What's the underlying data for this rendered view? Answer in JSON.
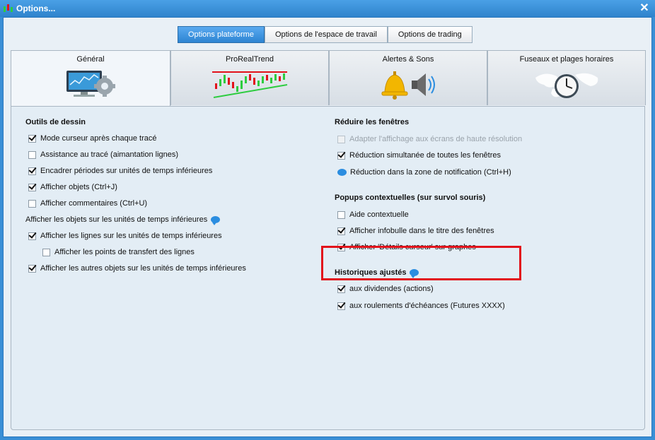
{
  "window": {
    "title": "Options..."
  },
  "top_tabs": [
    {
      "label": "Options plateforme",
      "active": true
    },
    {
      "label": "Options de l'espace de travail",
      "active": false
    },
    {
      "label": "Options de trading",
      "active": false
    }
  ],
  "tabs": [
    {
      "label": "Général",
      "icon": "monitor-gear-icon",
      "active": true
    },
    {
      "label": "ProRealTrend",
      "icon": "trend-chart-icon",
      "active": false
    },
    {
      "label": "Alertes & Sons",
      "icon": "bell-speaker-icon",
      "active": false
    },
    {
      "label": "Fuseaux et plages horaires",
      "icon": "world-clock-icon",
      "active": false
    }
  ],
  "left": {
    "drawing_title": "Outils de dessin",
    "drawing_options": [
      {
        "label": "Mode curseur après chaque tracé",
        "checked": true
      },
      {
        "label": "Assistance au tracé (aimantation lignes)",
        "checked": false
      },
      {
        "label": "Encadrer périodes sur unités de temps inférieures",
        "checked": true
      },
      {
        "label": "Afficher objets (Ctrl+J)",
        "checked": true
      },
      {
        "label": "Afficher commentaires (Ctrl+U)",
        "checked": false
      }
    ],
    "lower_units_title": "Afficher les objets sur les unités de temps inférieures",
    "lower_units_options": [
      {
        "label": "Afficher les lignes sur les unités de temps inférieures",
        "checked": true
      },
      {
        "label": "Afficher les points de transfert des lignes",
        "checked": false
      },
      {
        "label": "Afficher les autres objets sur les unités de temps inférieures",
        "checked": true
      }
    ]
  },
  "right": {
    "reduce_title": "Réduire les fenêtres",
    "reduce_options": [
      {
        "label": "Adapter l'affichage aux écrans de haute résolution",
        "checked": false,
        "disabled": true
      },
      {
        "label": "Réduction simultanée de toutes les fenêtres",
        "checked": true
      },
      {
        "label": "Réduction dans la zone de notification (Ctrl+H)",
        "checked": false
      }
    ],
    "popups_title": "Popups contextuelles (sur survol souris)",
    "popups_options": [
      {
        "label": "Aide contextuelle",
        "checked": false
      },
      {
        "label": "Afficher infobulle dans le titre des fenêtres",
        "checked": true
      },
      {
        "label": "Afficher 'Détails curseur' sur graphes",
        "checked": true
      }
    ],
    "history_title": "Historiques ajustés",
    "history_options": [
      {
        "label": "aux dividendes (actions)",
        "checked": true
      },
      {
        "label": "aux roulements d'échéances (Futures XXXX)",
        "checked": true
      }
    ]
  },
  "colors": {
    "highlight": "#e2121b",
    "accent": "#2d84d2"
  }
}
